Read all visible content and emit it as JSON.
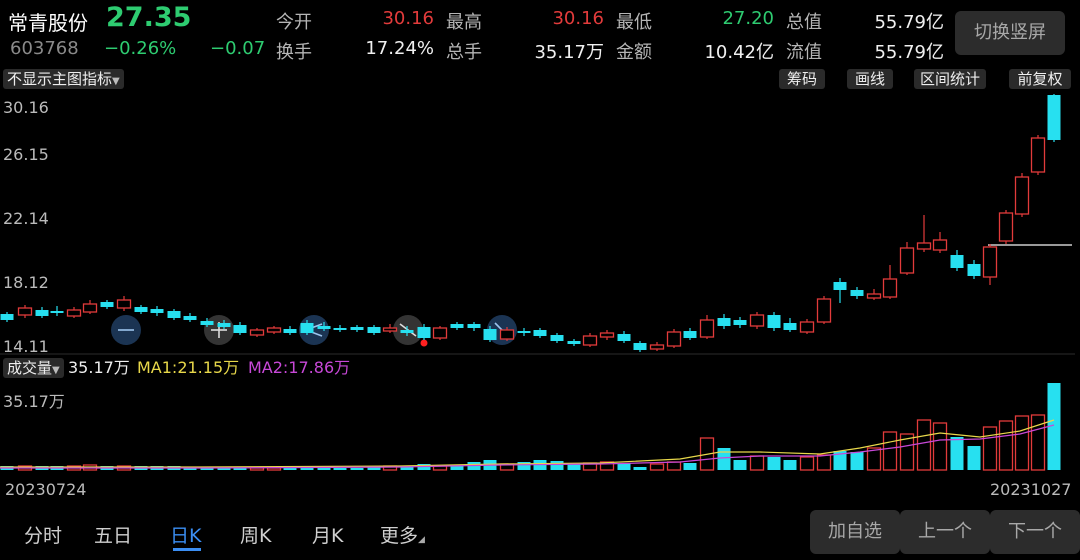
{
  "header": {
    "stock_name": "常青股份",
    "price": "27.35",
    "code": "603768",
    "change_pct": "−0.26%",
    "change_amt": "−0.07",
    "stats": {
      "open_label": "今开",
      "open_value": "30.16",
      "high_label": "最高",
      "high_value": "30.16",
      "low_label": "最低",
      "low_value": "27.20",
      "total_cap_label": "总值",
      "total_cap_value": "55.79亿",
      "turnover_label": "换手",
      "turnover_value": "17.24%",
      "total_vol_label": "总手",
      "total_vol_value": "35.17万",
      "amount_label": "金额",
      "amount_value": "10.42亿",
      "float_cap_label": "流值",
      "float_cap_value": "55.79亿"
    },
    "switch_label": "切换竖屏"
  },
  "main_chart": {
    "indicator_label": "不显示主图指标",
    "tools": [
      "筹码",
      "画线",
      "区间统计",
      "前复权"
    ],
    "y_ticks": [
      "30.16",
      "26.15",
      "22.14",
      "18.12",
      "14.11"
    ]
  },
  "volume_chart": {
    "indicator_label": "成交量",
    "current": "35.17万",
    "ma1": "MA1:21.15万",
    "ma2": "MA2:17.86万",
    "top_label": "35.17万"
  },
  "dates": {
    "start": "20230724",
    "end": "20231027"
  },
  "bottom_tabs": [
    "分时",
    "五日",
    "日K",
    "周K",
    "月K",
    "更多"
  ],
  "bottom_buttons": [
    "加自选",
    "上一个",
    "下一个"
  ],
  "colors": {
    "up": "#e23b3b",
    "down": "#27e0f0",
    "ma1": "#e8d84a",
    "ma2": "#c848d8",
    "tab_active": "#3b8ef3"
  }
}
